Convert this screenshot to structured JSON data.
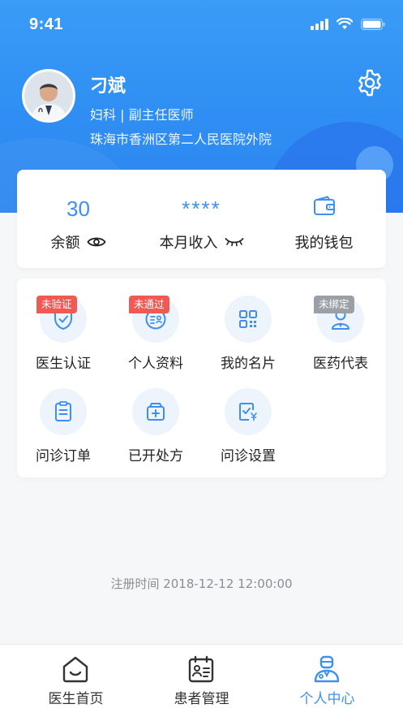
{
  "status_bar": {
    "time": "9:41"
  },
  "profile": {
    "name": "刁斌",
    "department_title": "妇科 | 副主任医师",
    "hospital": "珠海市香洲区第二人民医院外院"
  },
  "stats": [
    {
      "value": "30",
      "label": "余额",
      "icon": "eye-icon"
    },
    {
      "value": "****",
      "label": "本月收入",
      "icon": "eye-closed-icon"
    },
    {
      "label": "我的钱包",
      "icon": "wallet-icon"
    }
  ],
  "menu": [
    {
      "label": "医生认证",
      "icon": "shield-check-icon",
      "badge": "未验证",
      "badge_color": "#f05a55"
    },
    {
      "label": "个人资料",
      "icon": "profile-card-icon",
      "badge": "未通过",
      "badge_color": "#f05a55"
    },
    {
      "label": "我的名片",
      "icon": "qr-code-icon"
    },
    {
      "label": "医药代表",
      "icon": "representative-icon",
      "badge": "未绑定",
      "badge_color": "#9aa0a6"
    },
    {
      "label": "问诊订单",
      "icon": "order-list-icon"
    },
    {
      "label": "已开处方",
      "icon": "prescription-box-icon"
    },
    {
      "label": "问诊设置",
      "icon": "settings-fee-icon"
    }
  ],
  "registration": "注册时间 2018-12-12 12:00:00",
  "tabs": [
    {
      "label": "医生首页",
      "icon": "home-icon",
      "active": false
    },
    {
      "label": "患者管理",
      "icon": "patient-calendar-icon",
      "active": false
    },
    {
      "label": "个人中心",
      "icon": "doctor-person-icon",
      "active": true
    }
  ],
  "colors": {
    "primary": "#3d8ff0",
    "header": "#2f8ef3",
    "badge_red": "#f05a55",
    "badge_gray": "#9aa0a6"
  }
}
